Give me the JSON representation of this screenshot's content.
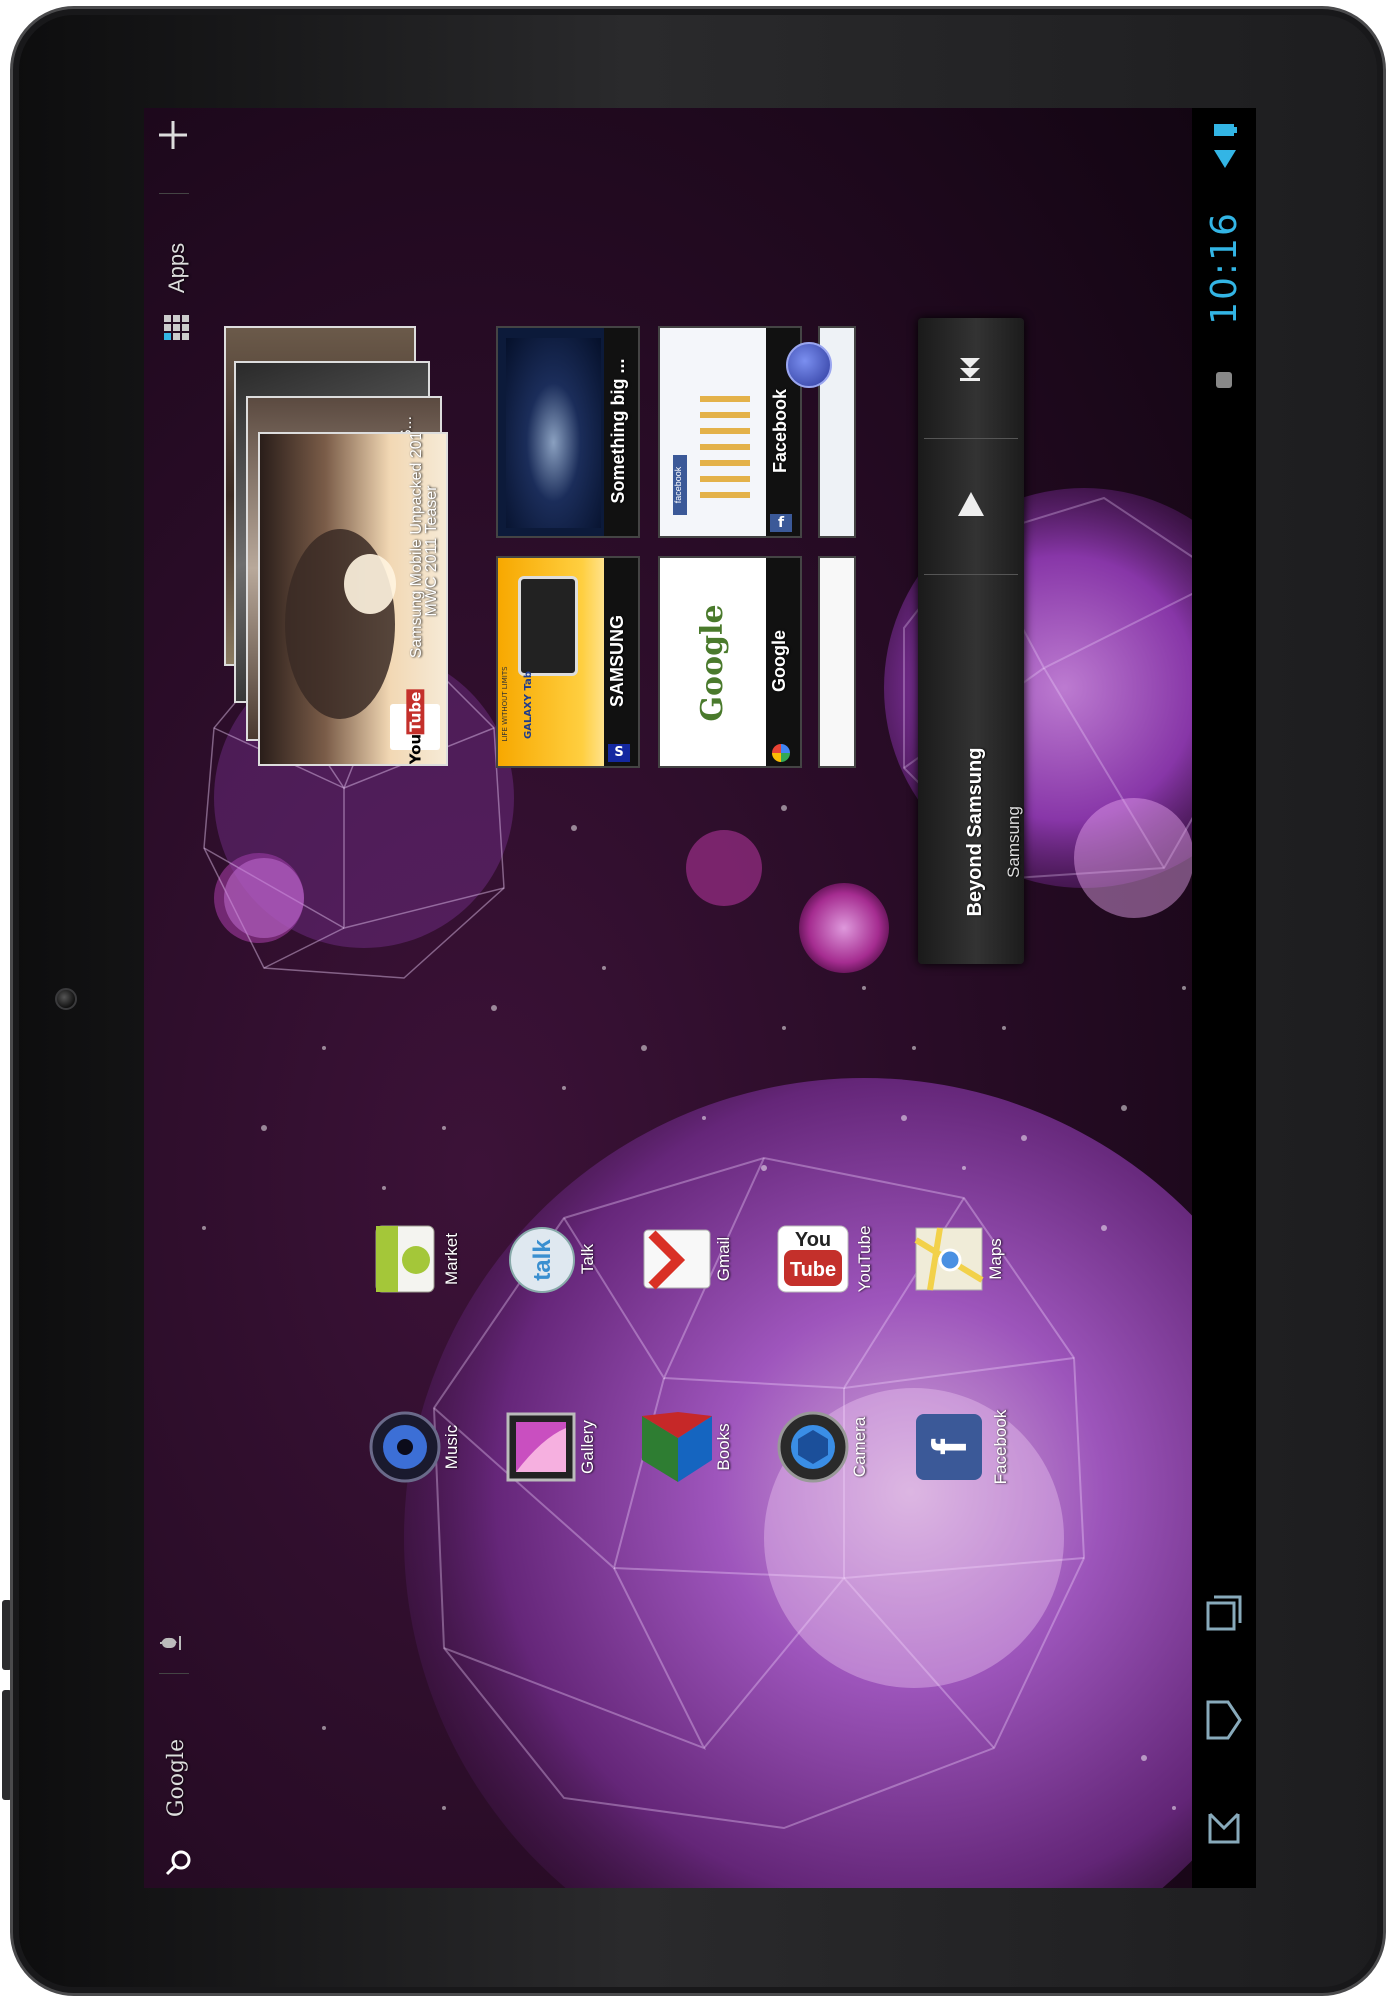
{
  "top_bar": {
    "search_label": "Google",
    "apps_label": "Apps"
  },
  "status_bar": {
    "time": "10:16"
  },
  "youtube_widget": {
    "video_title": "Samsung Mobile Unpacked 2011",
    "video_subtitle": "MWC 2011 Teaser",
    "thumb_text_2": "S..."
  },
  "bookmarks": [
    {
      "title": "Something big ..."
    },
    {
      "title": "Facebook"
    },
    {
      "title": "SAMSUNG"
    },
    {
      "title": "Google"
    }
  ],
  "music_widget": {
    "track": "Beyond Samsung",
    "artist": "Samsung"
  },
  "apps_row_1": [
    {
      "label": "Market",
      "icon": "market-icon"
    },
    {
      "label": "Talk",
      "icon": "talk-icon"
    },
    {
      "label": "Gmail",
      "icon": "gmail-icon"
    },
    {
      "label": "YouTube",
      "icon": "youtube-icon"
    },
    {
      "label": "Maps",
      "icon": "maps-icon"
    }
  ],
  "apps_row_2": [
    {
      "label": "Music",
      "icon": "music-icon"
    },
    {
      "label": "Gallery",
      "icon": "gallery-icon"
    },
    {
      "label": "Books",
      "icon": "books-icon"
    },
    {
      "label": "Camera",
      "icon": "camera-icon"
    },
    {
      "label": "Facebook",
      "icon": "facebook-icon"
    }
  ],
  "thumbnail_text": {
    "galaxy_brand": "Samsung",
    "galaxy_tab": "GALAXY Tab",
    "galaxy_tagline": "LIFE WITHOUT LIMITS",
    "google_logo": "Google",
    "facebook_header": "facebook"
  },
  "colors": {
    "accent_blue": "#33b5e5",
    "wallpaper_dark": "#21081f",
    "sphere_purple": "#b64fd8"
  }
}
